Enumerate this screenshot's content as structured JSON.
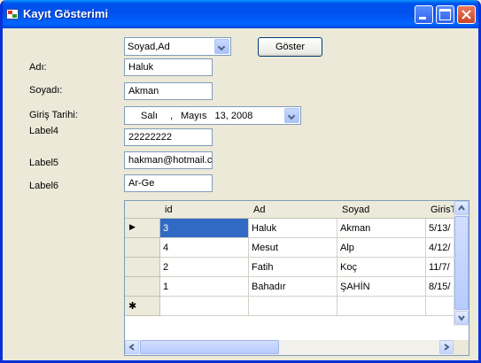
{
  "window": {
    "title": "Kayıt Gösterimi"
  },
  "form": {
    "sort_combo_value": "Soyad,Ad",
    "show_button": "Göster",
    "labels": {
      "adi": "Adı:",
      "soyadi": "Soyadı:",
      "giris_tarihi": "Giriş Tarihi:",
      "label4": "Label4",
      "label5": "Label5",
      "label6": "Label6"
    },
    "fields": {
      "adi": "Haluk",
      "soyadi": "Akman",
      "date_day": "Salı",
      "date_sep": ",",
      "date_rest": "Mayıs   13, 2008",
      "label4": "22222222",
      "label5": "hakman@hotmail.c",
      "label6": "Ar-Ge"
    }
  },
  "grid": {
    "columns": [
      "id",
      "Ad",
      "Soyad",
      "GirisT"
    ],
    "rows": [
      [
        "3",
        "Haluk",
        "Akman",
        "5/13/"
      ],
      [
        "4",
        "Mesut",
        "Alp",
        "4/12/"
      ],
      [
        "2",
        "Fatih",
        "Koç",
        "11/7/"
      ],
      [
        "1",
        "Bahadır",
        "ŞAHİN",
        "8/15/"
      ]
    ],
    "current_row_marker": "▶",
    "new_row_marker": "✱"
  }
}
